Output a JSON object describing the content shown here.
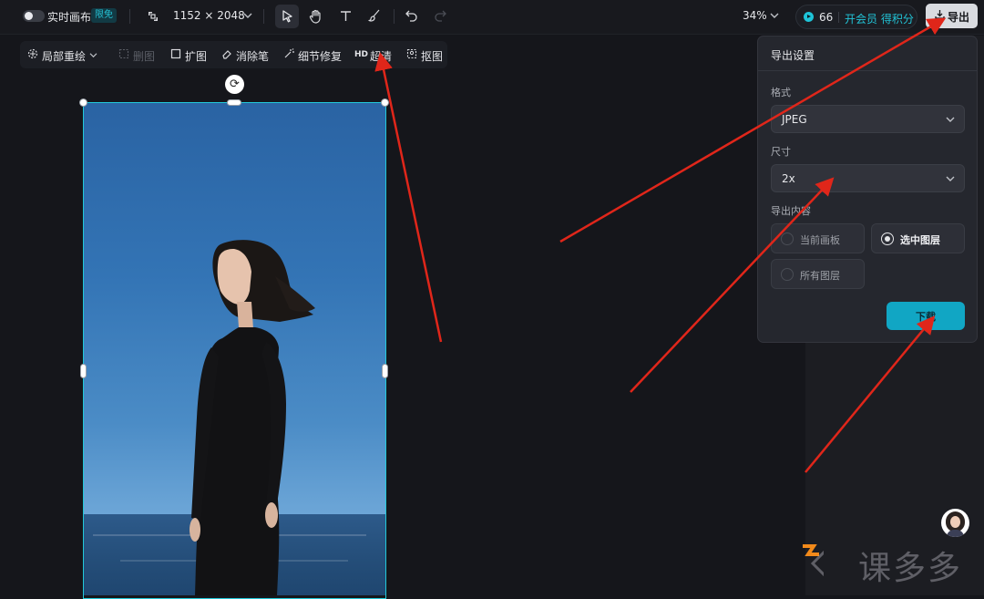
{
  "topbar": {
    "realtime_label": "实时画布",
    "free_badge": "限免",
    "canvas_size": "1152 × 2048",
    "zoom": "34%",
    "points": "66",
    "vip_label": "开会员 得积分",
    "export_label": "导出"
  },
  "subtoolbar": {
    "items": [
      "局部重绘",
      "删图",
      "扩图",
      "消除笔",
      "细节修复",
      "超清",
      "抠图"
    ],
    "hd_tag": "HD"
  },
  "export_panel": {
    "title": "导出设置",
    "format_label": "格式",
    "format_value": "JPEG",
    "size_label": "尺寸",
    "size_value": "2x",
    "content_label": "导出内容",
    "options": [
      {
        "label": "当前画板",
        "selected": false
      },
      {
        "label": "选中图层",
        "selected": true
      },
      {
        "label": "所有图层",
        "selected": false
      }
    ],
    "download_label": "下载"
  },
  "watermark": {
    "text": "课多多"
  },
  "colors": {
    "accent": "#22c3d6",
    "annotation_arrow": "#e0261a",
    "download_button": "#11a6c4"
  }
}
